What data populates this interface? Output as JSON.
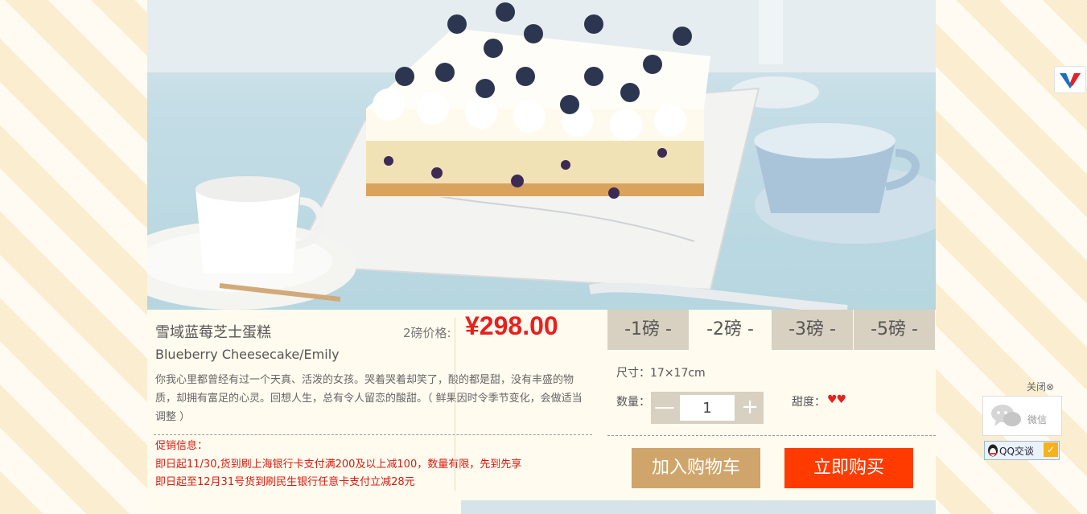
{
  "product": {
    "name_cn": "雪域蓝莓芝士蛋糕",
    "name_en": "Blueberry Cheesecake/Emily",
    "price_label": "2磅价格:",
    "price": "¥298.00",
    "description": "你我心里都曾经有过一个天真、活泼的女孩。哭着哭着却笑了，酸的都是甜，没有丰盛的物质，却拥有富足的心灵。回想人生，总有令人留恋的酸甜。（ 鲜果因时令季节变化，会做适当调整 ）",
    "promo_label": "促销信息：",
    "promos": [
      "即日起11/30,货到刷上海银行卡支付满200及以上减100，数量有限，先到先享",
      "即日起至12月31号货到刷民生银行任意卡支付立减28元"
    ]
  },
  "options": {
    "sizes": [
      "-1磅 -",
      "-2磅 -",
      "-3磅 -",
      "-5磅 -"
    ],
    "selected_size_index": 1,
    "dimension": "尺寸：17×17cm",
    "quantity_label": "数量：",
    "quantity": "1",
    "sweetness_label": "甜度：",
    "sweetness_hearts": "♥♥",
    "sweetness_level": 2
  },
  "actions": {
    "add_to_cart": "加入购物车",
    "buy_now": "立即购买",
    "minus": "—",
    "plus": "+"
  },
  "side_widget": {
    "close_label": "关闭⊗",
    "wechat_label": "微信",
    "qq_label": "QQ交谈",
    "qq_check": "✓"
  },
  "colors": {
    "price_red": "#e8201e",
    "cart_button": "#cfa56b",
    "buy_button": "#ff3b00",
    "tab_inactive": "#d8d1c1",
    "page_bg": "#fffbef"
  }
}
